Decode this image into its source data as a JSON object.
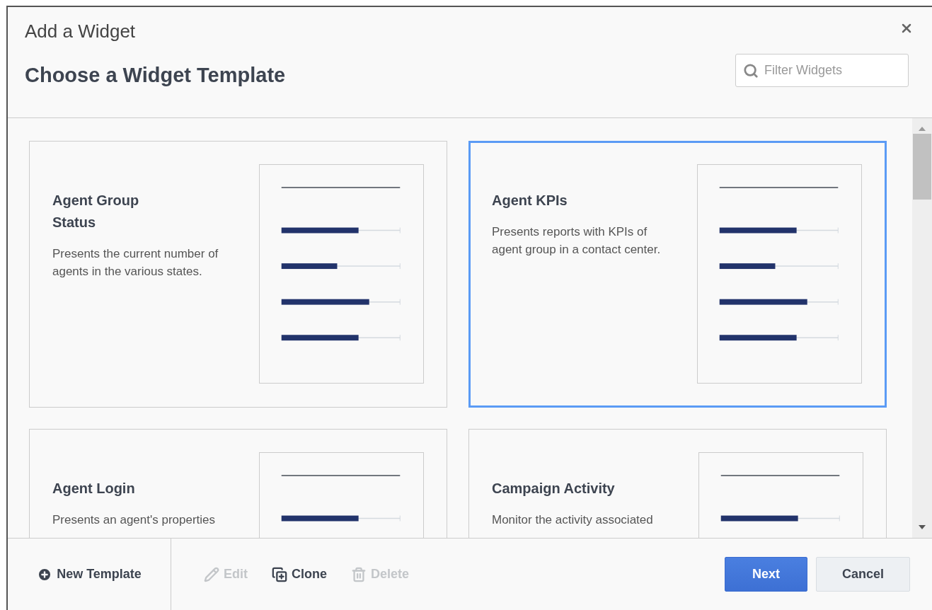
{
  "dialog": {
    "title": "Add a Widget",
    "heading": "Choose a Widget Template"
  },
  "filter": {
    "placeholder": "Filter Widgets"
  },
  "cards": [
    {
      "title": "Agent Group Status",
      "description": "Presents the current number of agents in the various states.",
      "selected": false
    },
    {
      "title": "Agent KPIs",
      "description": "Presents reports with KPIs of agent group in a contact center.",
      "selected": true
    },
    {
      "title": "Agent Login",
      "description": "Presents an agent's properties",
      "selected": false
    },
    {
      "title": "Campaign Activity",
      "description": "Monitor the activity associated",
      "selected": false
    }
  ],
  "footer": {
    "new_template": "New Template",
    "actions": [
      {
        "kind": "edit",
        "label": "Edit",
        "disabled": true
      },
      {
        "kind": "clone",
        "label": "Clone",
        "disabled": false
      },
      {
        "kind": "delete",
        "label": "Delete",
        "disabled": true
      }
    ],
    "buttons": [
      {
        "kind": "primary",
        "label": "Next"
      },
      {
        "kind": "secondary",
        "label": "Cancel"
      }
    ]
  }
}
